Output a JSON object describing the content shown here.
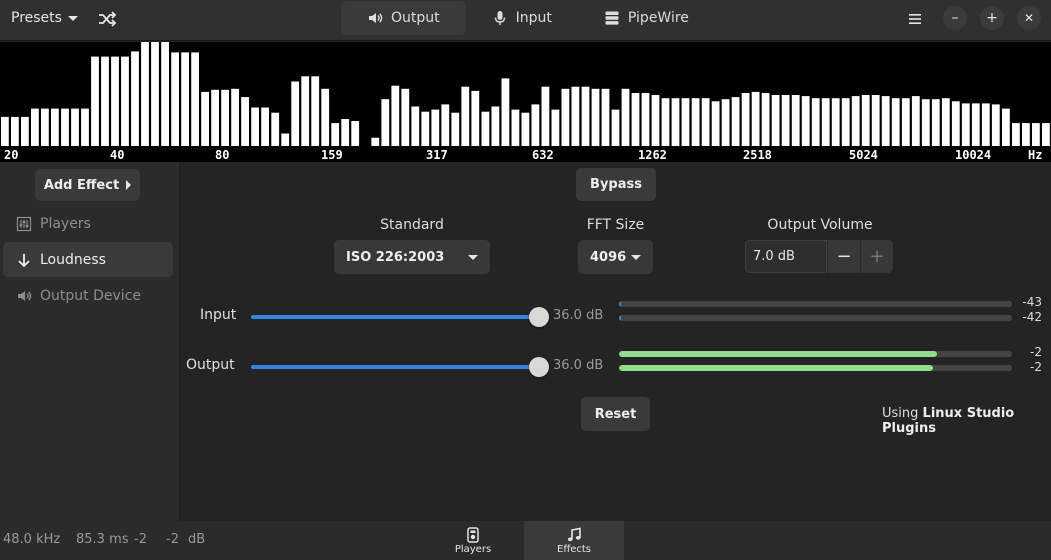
{
  "header": {
    "presets_label": "Presets",
    "tabs": [
      {
        "label": "Output",
        "icon": "speaker-icon",
        "active": true
      },
      {
        "label": "Input",
        "icon": "microphone-icon",
        "active": false
      },
      {
        "label": "PipeWire",
        "icon": "server-icon",
        "active": false
      }
    ],
    "window_controls": {
      "minimize": "–",
      "maximize": "+",
      "close": "✕"
    }
  },
  "spectrum": {
    "freq_labels": [
      "20",
      "40",
      "80",
      "159",
      "317",
      "632",
      "1262",
      "2518",
      "5024",
      "10024",
      "Hz"
    ],
    "bars": [
      0.28,
      0.28,
      0.28,
      0.36,
      0.36,
      0.36,
      0.36,
      0.36,
      0.36,
      0.86,
      0.86,
      0.86,
      0.86,
      0.91,
      1,
      1,
      1,
      0.9,
      0.9,
      0.9,
      0.52,
      0.54,
      0.54,
      0.55,
      0.47,
      0.37,
      0.37,
      0.32,
      0.12,
      0.62,
      0.67,
      0.67,
      0.55,
      0.22,
      0.26,
      0.24,
      0.0,
      0.08,
      0.45,
      0.58,
      0.55,
      0.38,
      0.33,
      0.35,
      0.4,
      0.32,
      0.57,
      0.53,
      0.33,
      0.38,
      0.65,
      0.35,
      0.32,
      0.4,
      0.57,
      0.35,
      0.55,
      0.57,
      0.57,
      0.55,
      0.55,
      0.35,
      0.55,
      0.51,
      0.51,
      0.49,
      0.46,
      0.46,
      0.46,
      0.46,
      0.46,
      0.43,
      0.45,
      0.47,
      0.51,
      0.52,
      0.51,
      0.49,
      0.49,
      0.49,
      0.48,
      0.46,
      0.46,
      0.46,
      0.46,
      0.48,
      0.49,
      0.49,
      0.48,
      0.46,
      0.46,
      0.48,
      0.45,
      0.45,
      0.46,
      0.43,
      0.41,
      0.41,
      0.41,
      0.4,
      0.36,
      0.22,
      0.22,
      0.22,
      0.22
    ]
  },
  "sidebar": {
    "add_effect_label": "Add Effect",
    "items": [
      {
        "label": "Players",
        "icon": "equalizer-icon",
        "state": "dim"
      },
      {
        "label": "Loudness",
        "icon": "arrow-down-icon",
        "state": "selected"
      },
      {
        "label": "Output Device",
        "icon": "speaker-icon",
        "state": "dim"
      }
    ]
  },
  "main": {
    "bypass_label": "Bypass",
    "standard": {
      "label": "Standard",
      "value": "ISO 226:2003"
    },
    "fft": {
      "label": "FFT Size",
      "value": "4096"
    },
    "output_volume": {
      "label": "Output Volume",
      "value": "7.0 dB",
      "minus": "−",
      "plus": "+"
    },
    "input": {
      "label": "Input",
      "gain_text": "36.0 dB",
      "gain_fraction": 1.0,
      "levels": [
        {
          "value": "-43",
          "fraction": 0.005
        },
        {
          "value": "-42",
          "fraction": 0.005
        }
      ]
    },
    "output": {
      "label": "Output",
      "gain_text": "36.0 dB",
      "gain_fraction": 1.0,
      "levels": [
        {
          "value": "-2",
          "fraction": 0.81
        },
        {
          "value": "-2",
          "fraction": 0.8
        }
      ]
    },
    "reset_label": "Reset",
    "using_prefix": "Using",
    "using_plugin": "Linux Studio Plugins"
  },
  "footer": {
    "sample_rate": "48.0 kHz",
    "latency": "85.3 ms",
    "level_l": "-2",
    "level_r": "-2",
    "unit": "dB",
    "tabs": [
      {
        "label": "Players",
        "icon": "player-icon",
        "active": false
      },
      {
        "label": "Effects",
        "icon": "music-note-icon",
        "active": true
      }
    ]
  },
  "colors": {
    "accent": "#3584e4",
    "level_fill": "#8fdc8c",
    "background": "#242424",
    "spectrum_bg": "#000000",
    "spectrum_bar": "#ffffff"
  }
}
